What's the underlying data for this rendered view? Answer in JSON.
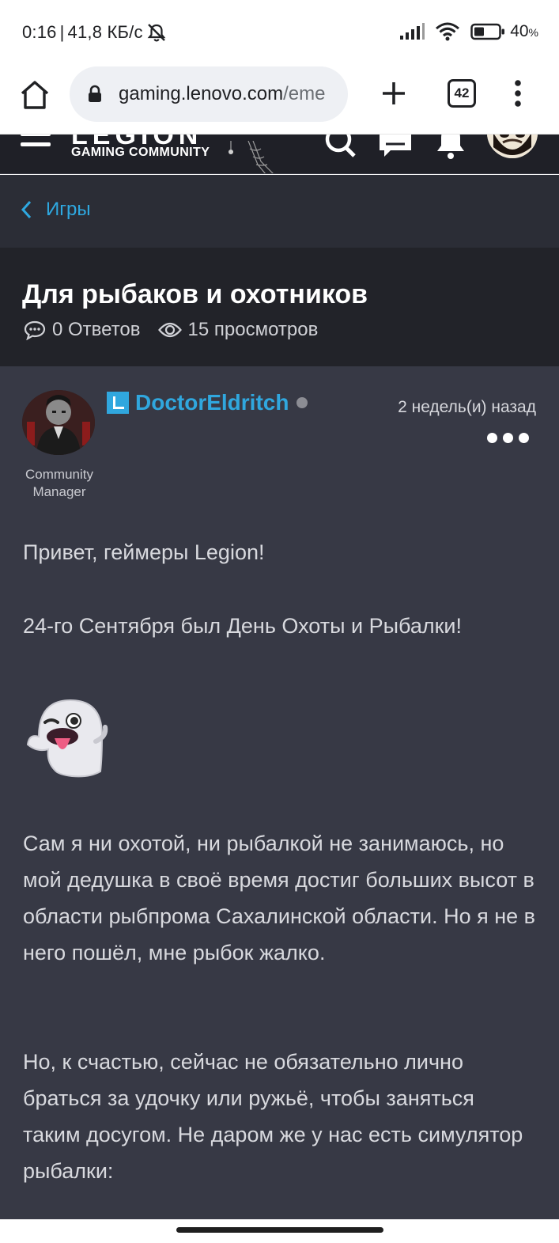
{
  "status_bar": {
    "time": "0:16",
    "separator": "|",
    "net_speed": "41,8 КБ/с",
    "battery": "40",
    "battery_unit": "%",
    "icons": [
      "mute-icon",
      "signal-icon",
      "wifi-icon",
      "battery-icon"
    ]
  },
  "browser": {
    "url_host": "gaming.lenovo.com",
    "url_path": "/eme",
    "tab_count": "42",
    "icons": [
      "home-icon",
      "lock-icon",
      "plus-icon",
      "more-vert-icon"
    ]
  },
  "site_header": {
    "logo_text": "LEGION",
    "logo_subtitle": "GAMING COMMUNITY",
    "icons": [
      "menu-icon",
      "search-icon",
      "chat-icon",
      "bell-icon",
      "avatar"
    ]
  },
  "breadcrumb": {
    "label": "Игры"
  },
  "topic": {
    "title": "Для рыбаков и охотников",
    "replies": "0 Ответов",
    "views": "15 просмотров"
  },
  "post": {
    "author": "DoctorEldritch",
    "role": "Community Manager",
    "time": "2 недель(и) назад",
    "paragraphs": [
      "Привет, геймеры Legion!",
      "24-го Сентября был День Охоты и Рыбалки!",
      "Сам я ни охотой, ни рыбалкой не занимаюсь, но мой дедушка в своё время достиг больших высот в области рыбпрома Сахалинской области. Но я не в него пошёл, мне рыбок жалко.",
      "Но, к счастью, сейчас не обязательно лично браться за удочку или ружьё, чтобы заняться таким досугом. Не даром же у нас есть симулятор рыбалки:"
    ],
    "emoji": "ghost-icon"
  },
  "colors": {
    "accent": "#30a7de",
    "post_bg": "#373945",
    "title_bg": "#222329",
    "breadcrumb_bg": "#2b2d36",
    "header_bg": "#1f2027"
  }
}
